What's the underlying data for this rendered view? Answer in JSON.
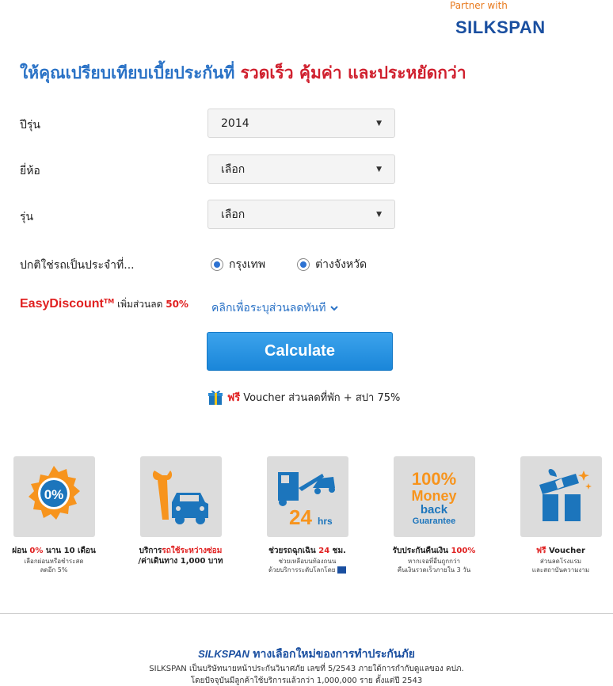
{
  "partner": {
    "caption": "Partner with",
    "brand": "SILKSPAN"
  },
  "headline": {
    "part1": "ให้คุณเปรียบเทียบเบี้ยประกันที่",
    "part2": "รวดเร็ว คุ้มค่า และประหยัดกว่า"
  },
  "form": {
    "year": {
      "label": "ปีรุ่น",
      "value": "2014"
    },
    "make": {
      "label": "ยี่ห้อ",
      "value": "เลือก"
    },
    "model": {
      "label": "รุ่น",
      "value": "เลือก"
    },
    "usage": {
      "label": "ปกติใช่รถเป็นประจำที่...",
      "options": [
        {
          "label": "กรุงเทพ",
          "selected": true
        },
        {
          "label": "ต่างจังหวัด",
          "selected": true
        }
      ]
    }
  },
  "easy_discount": {
    "brand": "EasyDiscount",
    "tm": "TM",
    "text": "เพิ่มส่วนลด",
    "percent": "50%",
    "link": "คลิกเพื่อระบุส่วนลดทันที"
  },
  "calculate_label": "Calculate",
  "voucher": {
    "free": "ฟรี",
    "text": "Voucher ส่วนลดที่พัก + สปา 75%"
  },
  "features": [
    {
      "tile_text": "0%",
      "title_pre": "ผ่อน ",
      "title_red": "0%",
      "title_post": " นาน 10 เดือน",
      "sub1": "เลือกผ่อนหรือชำระสด",
      "sub2": "ลดอีก 5%"
    },
    {
      "tile_text": "",
      "title_pre": "บริการ",
      "title_red": "รถใช้ระหว่างซ่อม",
      "title_post": "",
      "title_line2": "/ค่าเดินทาง 1,000 บาท",
      "sub1": "",
      "sub2": ""
    },
    {
      "tile_text": "24 hrs",
      "title_pre": "ช่วยรถฉุกเฉิน ",
      "title_red": "24",
      "title_post": " ชม.",
      "sub1": "ช่วยเหลือบนท้องถนน",
      "sub2": "ด้วยบริการระดับโลกโดย"
    },
    {
      "tile_text": "100% Money back Guarantee",
      "title_pre": "รับประกันคืนเงิน ",
      "title_red": "100%",
      "title_post": "",
      "sub1": "หากเจอที่อื่นถูกกว่า",
      "sub2": "คืนเงินรวดเร็วภายใน 3 วัน"
    },
    {
      "tile_text": "",
      "title_pre": "",
      "title_red": "ฟรี",
      "title_post": " Voucher",
      "sub1": "ส่วนลดโรงแรม",
      "sub2": "และสถาบันความงาม"
    }
  ],
  "footer": {
    "brand": "SILKSPAN",
    "tagline": "ทางเลือกใหม่ของการทำประกันภัย",
    "line1": "SILKSPAN เป็นบริษัทนายหน้าประกันวินาศภัย เลขที่ 5/2543 ภายใต้การกำกับดูแลของ คปภ.",
    "line2": "โดยปัจจุบันมีลูกค้าใช้บริการแล้วกว่า 1,000,000 ราย ตั้งแต่ปี 2543"
  },
  "colors": {
    "brand_blue": "#1a4fa0",
    "accent_red": "#d0202e",
    "button_blue": "#1a86d9",
    "tile_orange": "#f7941d",
    "tile_blue": "#1c75bc"
  }
}
